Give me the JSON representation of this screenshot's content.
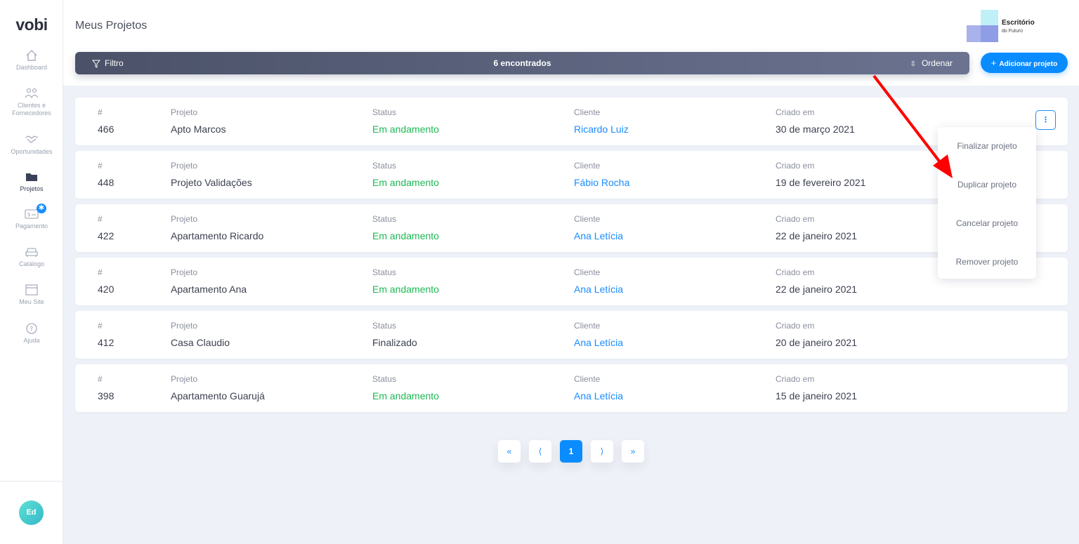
{
  "sidebar": {
    "logo": "vobi",
    "items": [
      {
        "label": "Dashboard",
        "icon": "home-icon"
      },
      {
        "label": "Clientes e Fornecedores",
        "icon": "users-icon"
      },
      {
        "label": "Oportunidades",
        "icon": "handshake-icon"
      },
      {
        "label": "Projetos",
        "icon": "folder-icon",
        "active": true
      },
      {
        "label": "Pagamento",
        "icon": "payment-icon",
        "badge": "✱"
      },
      {
        "label": "Catálogo",
        "icon": "sofa-icon"
      },
      {
        "label": "Meu Site",
        "icon": "browser-icon"
      },
      {
        "label": "Ajuda",
        "icon": "help-icon"
      }
    ],
    "avatar_initials": "Ed"
  },
  "header": {
    "title": "Meus Projetos",
    "company_name": "Escritório",
    "company_sub": "do Futuro"
  },
  "toolbar": {
    "filter_label": "Filtro",
    "found_label": "6 encontrados",
    "sort_label": "Ordenar",
    "add_label": "Adicionar projeto"
  },
  "table": {
    "headers": {
      "id": "#",
      "project": "Projeto",
      "status": "Status",
      "client": "Cliente",
      "created": "Criado em"
    },
    "rows": [
      {
        "id": "466",
        "project": "Apto Marcos",
        "status": "Em andamento",
        "client": "Ricardo Luiz",
        "created": "30 de março 2021"
      },
      {
        "id": "448",
        "project": "Projeto Validações",
        "status": "Em andamento",
        "client": "Fábio Rocha",
        "created": "19 de fevereiro 2021"
      },
      {
        "id": "422",
        "project": "Apartamento Ricardo",
        "status": "Em andamento",
        "client": "Ana Letícia",
        "created": "22 de janeiro 2021"
      },
      {
        "id": "420",
        "project": "Apartamento Ana",
        "status": "Em andamento",
        "client": "Ana Letícia",
        "created": "22 de janeiro 2021"
      },
      {
        "id": "412",
        "project": "Casa Claudio",
        "status": "Finalizado",
        "client": "Ana Letícia",
        "created": "20 de janeiro 2021"
      },
      {
        "id": "398",
        "project": "Apartamento Guarujá",
        "status": "Em andamento",
        "client": "Ana Letícia",
        "created": "15 de janeiro 2021"
      }
    ]
  },
  "row_menu": {
    "items": [
      "Finalizar projeto",
      "Duplicar projeto",
      "Cancelar projeto",
      "Remover projeto"
    ]
  },
  "pagination": {
    "first": "«",
    "prev": "⟨",
    "current": "1",
    "next": "⟩",
    "last": "»"
  },
  "colors": {
    "accent": "#0a8cff",
    "status_active": "#1db954",
    "annotation_arrow": "#ff0000"
  }
}
